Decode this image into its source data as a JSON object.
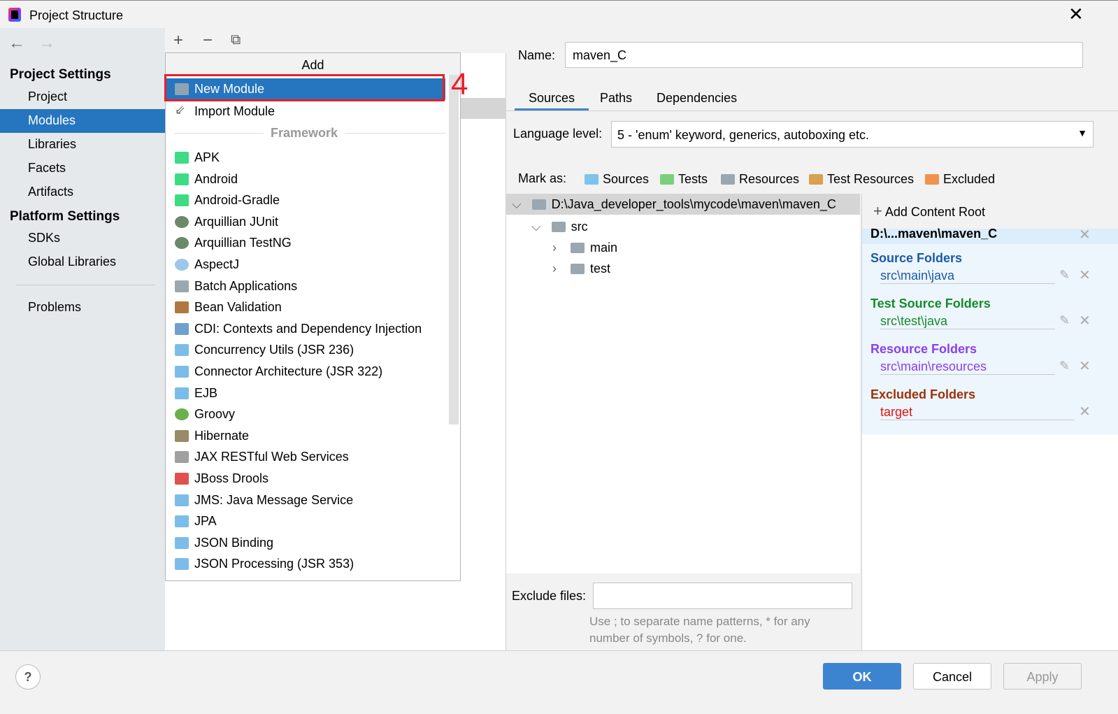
{
  "window": {
    "title": "Project Structure",
    "close": "✕"
  },
  "sidebar": {
    "back": "←",
    "forward": "→",
    "project_settings": "Project Settings",
    "project_items": [
      "Project",
      "Modules",
      "Libraries",
      "Facets",
      "Artifacts"
    ],
    "platform_settings": "Platform Settings",
    "platform_items": [
      "SDKs",
      "Global Libraries"
    ],
    "problems": "Problems"
  },
  "toolbar": {
    "add": "+",
    "remove": "−",
    "copy": "⧉"
  },
  "popup": {
    "title": "Add",
    "new_module": "New Module",
    "import_module": "Import Module",
    "framework_label": "Framework",
    "frameworks": [
      "APK",
      "Android",
      "Android-Gradle",
      "Arquillian JUnit",
      "Arquillian TestNG",
      "AspectJ",
      "Batch Applications",
      "Bean Validation",
      "CDI: Contexts and Dependency Injection",
      "Concurrency Utils (JSR 236)",
      "Connector Architecture (JSR 322)",
      "EJB",
      "Groovy",
      "Hibernate",
      "JAX RESTful Web Services",
      "JBoss Drools",
      "JMS: Java Message Service",
      "JPA",
      "JSON Binding",
      "JSON Processing (JSR 353)"
    ]
  },
  "annotation": "4",
  "module": {
    "name_label": "Name:",
    "name_value": "maven_C",
    "tabs": [
      "Sources",
      "Paths",
      "Dependencies"
    ],
    "language_label": "Language level:",
    "language_value": "5 - 'enum' keyword, generics, autoboxing etc.",
    "mark_as": "Mark as:",
    "marks": [
      "Sources",
      "Tests",
      "Resources",
      "Test Resources",
      "Excluded"
    ]
  },
  "tree": {
    "root": "D:\\Java_developer_tools\\mycode\\maven\\maven_C",
    "src": "src",
    "main": "main",
    "test": "test"
  },
  "exclude": {
    "label": "Exclude files:",
    "value": "",
    "hint": "Use ; to separate name patterns, * for any number of symbols, ? for one."
  },
  "content_root": {
    "add": "Add Content Root",
    "root": "D:\\...maven\\maven_C",
    "groups": [
      {
        "title": "Source Folders",
        "path": "src\\main\\java",
        "color": "#1a5aa8"
      },
      {
        "title": "Test Source Folders",
        "path": "src\\test\\java",
        "color": "#168a2c"
      },
      {
        "title": "Resource Folders",
        "path": "src\\main\\resources",
        "color": "#8a3ff0"
      },
      {
        "title": "Excluded Folders",
        "path": "target",
        "color": "#9c3208"
      }
    ]
  },
  "buttons": {
    "help": "?",
    "ok": "OK",
    "cancel": "Cancel",
    "apply": "Apply"
  }
}
